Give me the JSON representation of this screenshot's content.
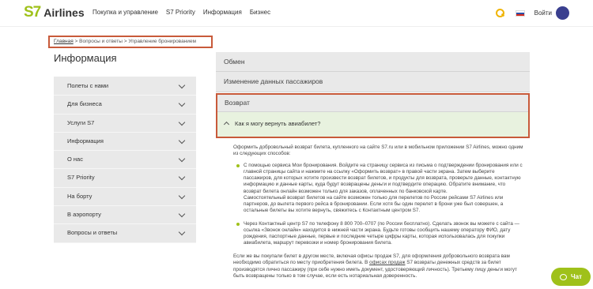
{
  "header": {
    "logo_mark": "S7",
    "logo_text": "Airlines",
    "nav": [
      "Покупка и управление",
      "S7 Priority",
      "Информация",
      "Бизнес"
    ],
    "login": "Войти",
    "icons": [
      "search-icon",
      "russia-flag-icon",
      "avatar"
    ]
  },
  "breadcrumb": {
    "home": "Главная",
    "sep1": " > ",
    "section": "Вопросы и ответы",
    "sep2": " > ",
    "current": "Управление бронированием"
  },
  "page_title": "Информация",
  "sidebar": {
    "items": [
      {
        "label": "Полеты с нами"
      },
      {
        "label": "Для бизнеса"
      },
      {
        "label": "Услуги S7"
      },
      {
        "label": "Информация"
      },
      {
        "label": "О нас"
      },
      {
        "label": "S7 Priority"
      },
      {
        "label": "На борту"
      },
      {
        "label": "В аэропорту"
      },
      {
        "label": "Вопросы и ответы"
      }
    ]
  },
  "content": {
    "accordion": [
      {
        "label": "Обмен"
      },
      {
        "label": "Изменение данных пассажиров"
      }
    ],
    "active_section": "Возврат",
    "question": "Как я могу вернуть авиабилет?",
    "answer": {
      "intro": "Оформить добровольный возврат билета, купленного на сайте S7.ru или в мобильном приложении S7 Airlines, можно одним из следующих способов:",
      "bullet1": "С помощью сервиса Мои бронирования. Войдите на страницу сервиса из письма о подтверждении бронирования или с главной страницы сайта и нажмите на ссылку «Оформить возврат» в правой части экрана. Затем выберите пассажиров, для которых хотите произвести возврат билетов, и продукты для возврата, проверьте данные, контактную информацию и данные карты, куда будут возвращены деньги и подтвердите операцию. Обратите внимание, что возврат билета онлайн возможен только для заказов, оплаченных по банковской карте.",
      "bullet1b": "Самостоятельный возврат билетов на сайте возможен только для перелетов по России рейсами S7 Airlines или партнеров, до вылета первого рейса в бронировании. Если хотя бы один перелет в брони уже был совершен, а остальные билеты вы хотите вернуть, свяжитесь с Контактным центром S7.",
      "bullet2": "Через Контактный центр S7 по телефону 8 800 700–0707 (по России бесплатно). Сделать звонок вы можете с сайта — ссылка «Звонок онлайн» находится в нижней части экрана. Будьте готовы сообщить нашему оператору ФИО, дату рождения, паспортные данные, первые и последние четыре цифры карты, которая использовалась для покупки авиабилета, маршрут перевозки и номер бронирования билета.",
      "outro_a": "Если же вы покупали билет в другом месте, включая офисы продаж S7, для оформления добровольного возврата вам необходимо обратиться по месту приобретения билета. В ",
      "outro_link": "офисах продаж",
      "outro_b": " S7 возвраты денежных средств за билет производятся лично пассажиру (при себе нужно иметь документ, удостоверяющий личность). Третьему лицу деньги могут быть возвращены только в том случае, если есть нотариальная доверенность."
    }
  },
  "chat": {
    "label": "Чат"
  },
  "colors": {
    "brand_green": "#9fc11a",
    "highlight_border": "#c85a3a",
    "question_bg": "#e8f2df"
  }
}
